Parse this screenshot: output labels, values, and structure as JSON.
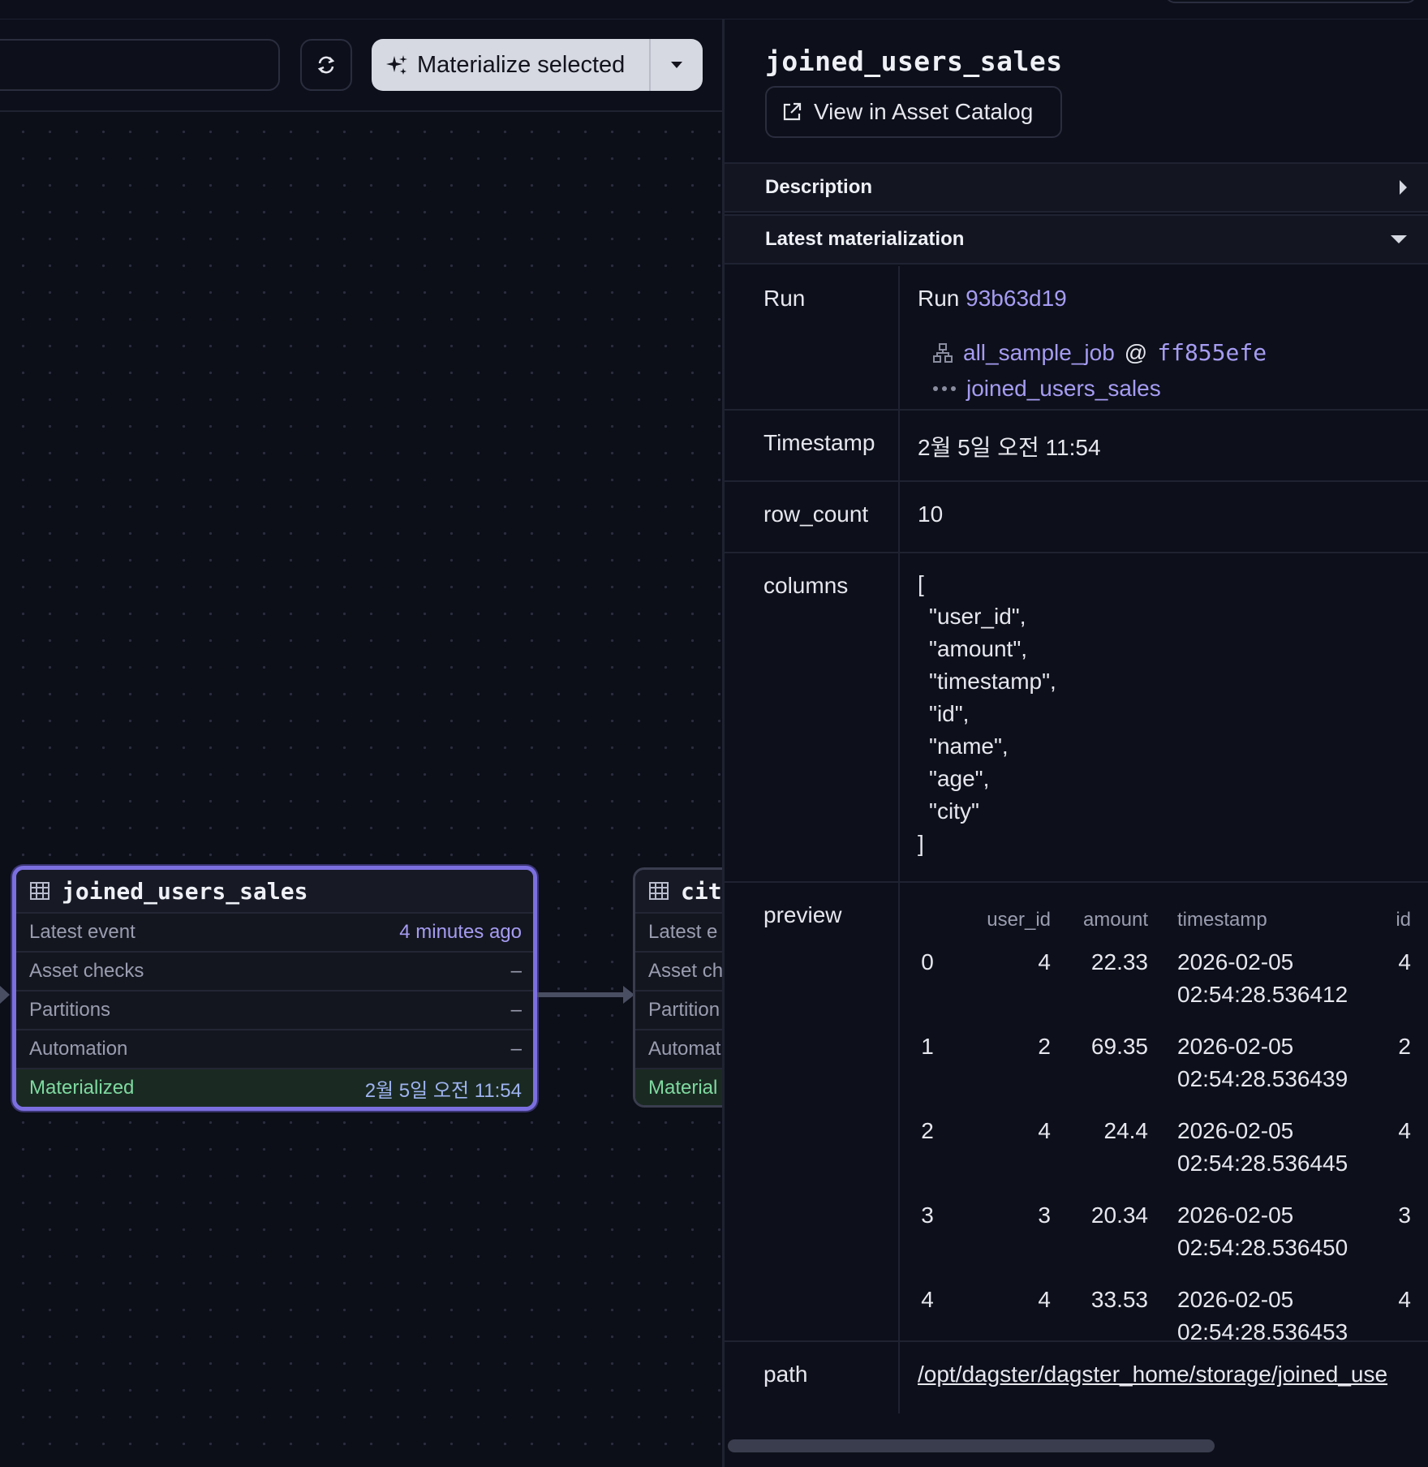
{
  "toolbar": {
    "materialize_label": "Materialize selected"
  },
  "nodes": {
    "main": {
      "name": "joined_users_sales",
      "rows": [
        {
          "label": "Latest event",
          "value": "4 minutes ago"
        },
        {
          "label": "Asset checks",
          "value": "–"
        },
        {
          "label": "Partitions",
          "value": "–"
        },
        {
          "label": "Automation",
          "value": "–"
        },
        {
          "label": "Materialized",
          "value": "2월 5일 오전 11:54"
        }
      ]
    },
    "city": {
      "name": "city",
      "rows": [
        {
          "label": "Latest e"
        },
        {
          "label": "Asset ch"
        },
        {
          "label": "Partition"
        },
        {
          "label": "Automat"
        },
        {
          "label": "Material"
        }
      ]
    }
  },
  "sidebar": {
    "title": "joined_users_sales",
    "catalog_button": "View in Asset Catalog",
    "sections": {
      "description": "Description",
      "latest": "Latest materialization"
    },
    "meta": {
      "run_label": "Run",
      "run_prefix": "Run",
      "run_id": "93b63d19",
      "job_name": "all_sample_job",
      "job_at": "@",
      "job_hash": "ff855efe",
      "op_name": "joined_users_sales",
      "timestamp_label": "Timestamp",
      "timestamp_value": "2월 5일 오전 11:54",
      "row_count_label": "row_count",
      "row_count_value": "10",
      "columns_label": "columns",
      "columns_open": "[",
      "columns": [
        "\"user_id\",",
        "\"amount\",",
        "\"timestamp\",",
        "\"id\",",
        "\"name\",",
        "\"age\",",
        "\"city\""
      ],
      "columns_close": "]",
      "preview_label": "preview",
      "preview_headers": [
        "user_id",
        "amount",
        "timestamp",
        "id"
      ],
      "preview_rows": [
        {
          "idx": "0",
          "user_id": "4",
          "amount": "22.33",
          "date": "2026-02-05",
          "time": "02:54:28.536412",
          "id": "4"
        },
        {
          "idx": "1",
          "user_id": "2",
          "amount": "69.35",
          "date": "2026-02-05",
          "time": "02:54:28.536439",
          "id": "2"
        },
        {
          "idx": "2",
          "user_id": "4",
          "amount": "24.4",
          "date": "2026-02-05",
          "time": "02:54:28.536445",
          "id": "4"
        },
        {
          "idx": "3",
          "user_id": "3",
          "amount": "20.34",
          "date": "2026-02-05",
          "time": "02:54:28.536450",
          "id": "3"
        },
        {
          "idx": "4",
          "user_id": "4",
          "amount": "33.53",
          "date": "2026-02-05",
          "time": "02:54:28.536453",
          "id": "4"
        }
      ],
      "path_label": "path",
      "path_value": "/opt/dagster/dagster_home/storage/joined_use"
    }
  }
}
